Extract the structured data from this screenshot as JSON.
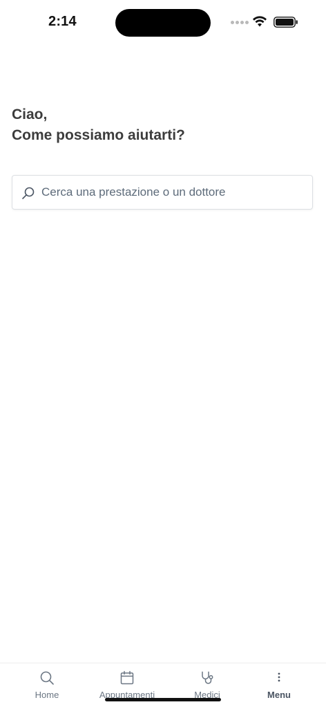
{
  "status_bar": {
    "time": "2:14",
    "icons": [
      "signal-dots-icon",
      "wifi-icon",
      "battery-icon"
    ]
  },
  "greeting": {
    "line1": "Ciao,",
    "line2": "Come possiamo aiutarti?"
  },
  "search": {
    "placeholder": "Cerca una prestazione o un dottore",
    "value": "",
    "icon": "search-icon"
  },
  "tab_bar": {
    "items": [
      {
        "label": "Home",
        "icon": "search-icon",
        "active": false
      },
      {
        "label": "Appuntamenti",
        "icon": "calendar-icon",
        "active": false
      },
      {
        "label": "Medici",
        "icon": "stethoscope-icon",
        "active": false
      },
      {
        "label": "Menu",
        "icon": "more-vertical-icon",
        "active": true
      }
    ]
  },
  "colors": {
    "text_primary": "#3c3c3c",
    "tab_inactive": "#6b7683",
    "tab_active": "#4b5563",
    "border": "#dcdfe3"
  }
}
